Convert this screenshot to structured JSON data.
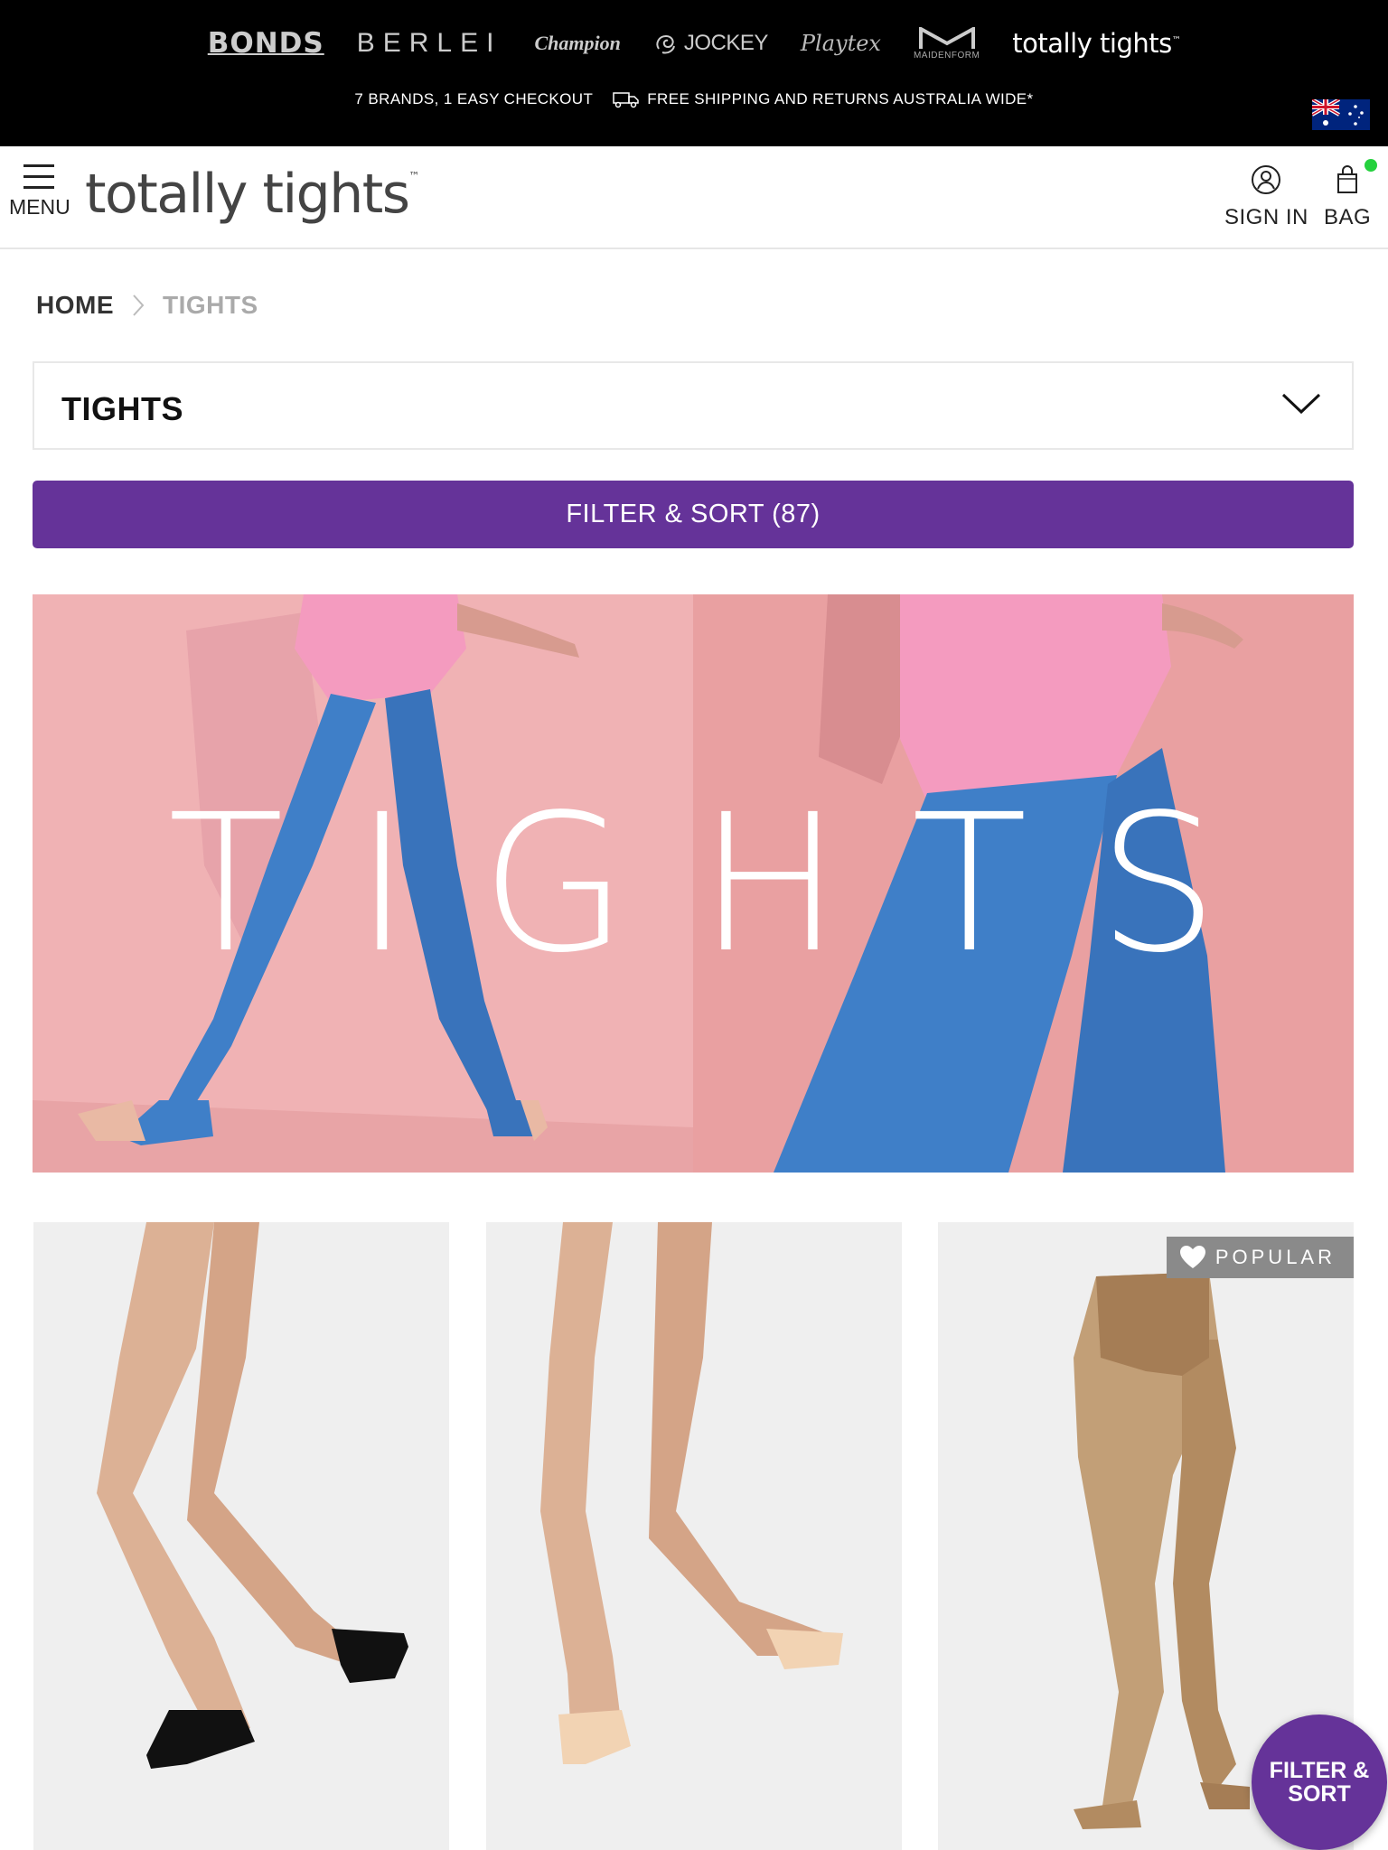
{
  "brand_bar": {
    "brands": [
      {
        "name": "BONDS"
      },
      {
        "name": "BERLEI"
      },
      {
        "name": "Champion"
      },
      {
        "name": "JOCKEY"
      },
      {
        "name": "Playtex"
      },
      {
        "name": "MAIDENFORM"
      },
      {
        "name": "totally tights"
      }
    ],
    "promo_checkout": "7 BRANDS, 1 EASY CHECKOUT",
    "promo_shipping": "FREE SHIPPING AND RETURNS AUSTRALIA WIDE*",
    "flag_icon": "australia-flag-icon"
  },
  "header": {
    "menu_label": "MENU",
    "logo_text": "totally tights",
    "logo_tm": "™",
    "signin_label": "SIGN IN",
    "bag_label": "BAG",
    "bag_indicator_color": "#25d13e"
  },
  "breadcrumb": {
    "home": "HOME",
    "current": "TIGHTS"
  },
  "category_select": {
    "selected": "TIGHTS"
  },
  "filter": {
    "button_label": "FILTER & SORT (87)",
    "fab_line1": "FILTER &",
    "fab_line2": "SORT",
    "accent_color": "#653399"
  },
  "hero": {
    "title": "TIGHTS"
  },
  "products": [
    {
      "image": "black-no-show-liner-socks"
    },
    {
      "image": "nude-no-show-liner-socks"
    },
    {
      "image": "sheer-nude-pantyhose",
      "badge": "POPULAR",
      "badge_icon": "heart-icon"
    }
  ]
}
